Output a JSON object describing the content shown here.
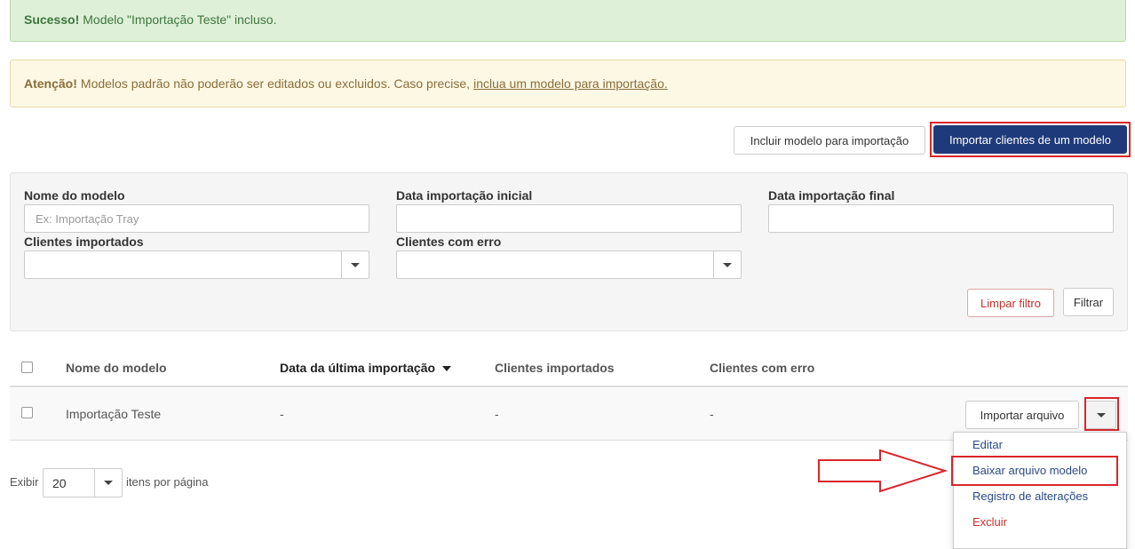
{
  "alerts": {
    "success": {
      "strong": "Sucesso!",
      "text": "Modelo \"Importação Teste\" incluso."
    },
    "warning": {
      "strong": "Atenção!",
      "text": "Modelos padrão não poderão ser editados ou excluidos. Caso precise,",
      "link": "inclua um modelo para importação."
    }
  },
  "toolbar": {
    "include_label": "Incluir modelo para importação",
    "import_label": "Importar clientes de um modelo"
  },
  "filters": {
    "name_label": "Nome do modelo",
    "name_placeholder": "Ex: Importação Tray",
    "start_date_label": "Data importação inicial",
    "end_date_label": "Data importação final",
    "imported_label": "Clientes importados",
    "errors_label": "Clientes com erro",
    "clear_label": "Limpar filtro",
    "filter_label": "Filtrar"
  },
  "table": {
    "columns": [
      "Nome do modelo",
      "Data da última importação",
      "Clientes importados",
      "Clientes com erro"
    ],
    "rows": [
      {
        "name": "Importação Teste",
        "last_import": "-",
        "imported": "-",
        "errors": "-",
        "action_label": "Importar arquivo"
      }
    ]
  },
  "dropdown": {
    "items": [
      "Editar",
      "Baixar arquivo modelo",
      "Registro de alterações",
      "Excluir"
    ]
  },
  "pagination": {
    "show_label": "Exibir",
    "per_page_value": "20",
    "per_page_suffix": "itens por página"
  },
  "colors": {
    "primary": "#1f3a7a",
    "highlight": "#d9262b",
    "success_bg": "#dff0d8",
    "warning_bg": "#fcf8e3"
  }
}
